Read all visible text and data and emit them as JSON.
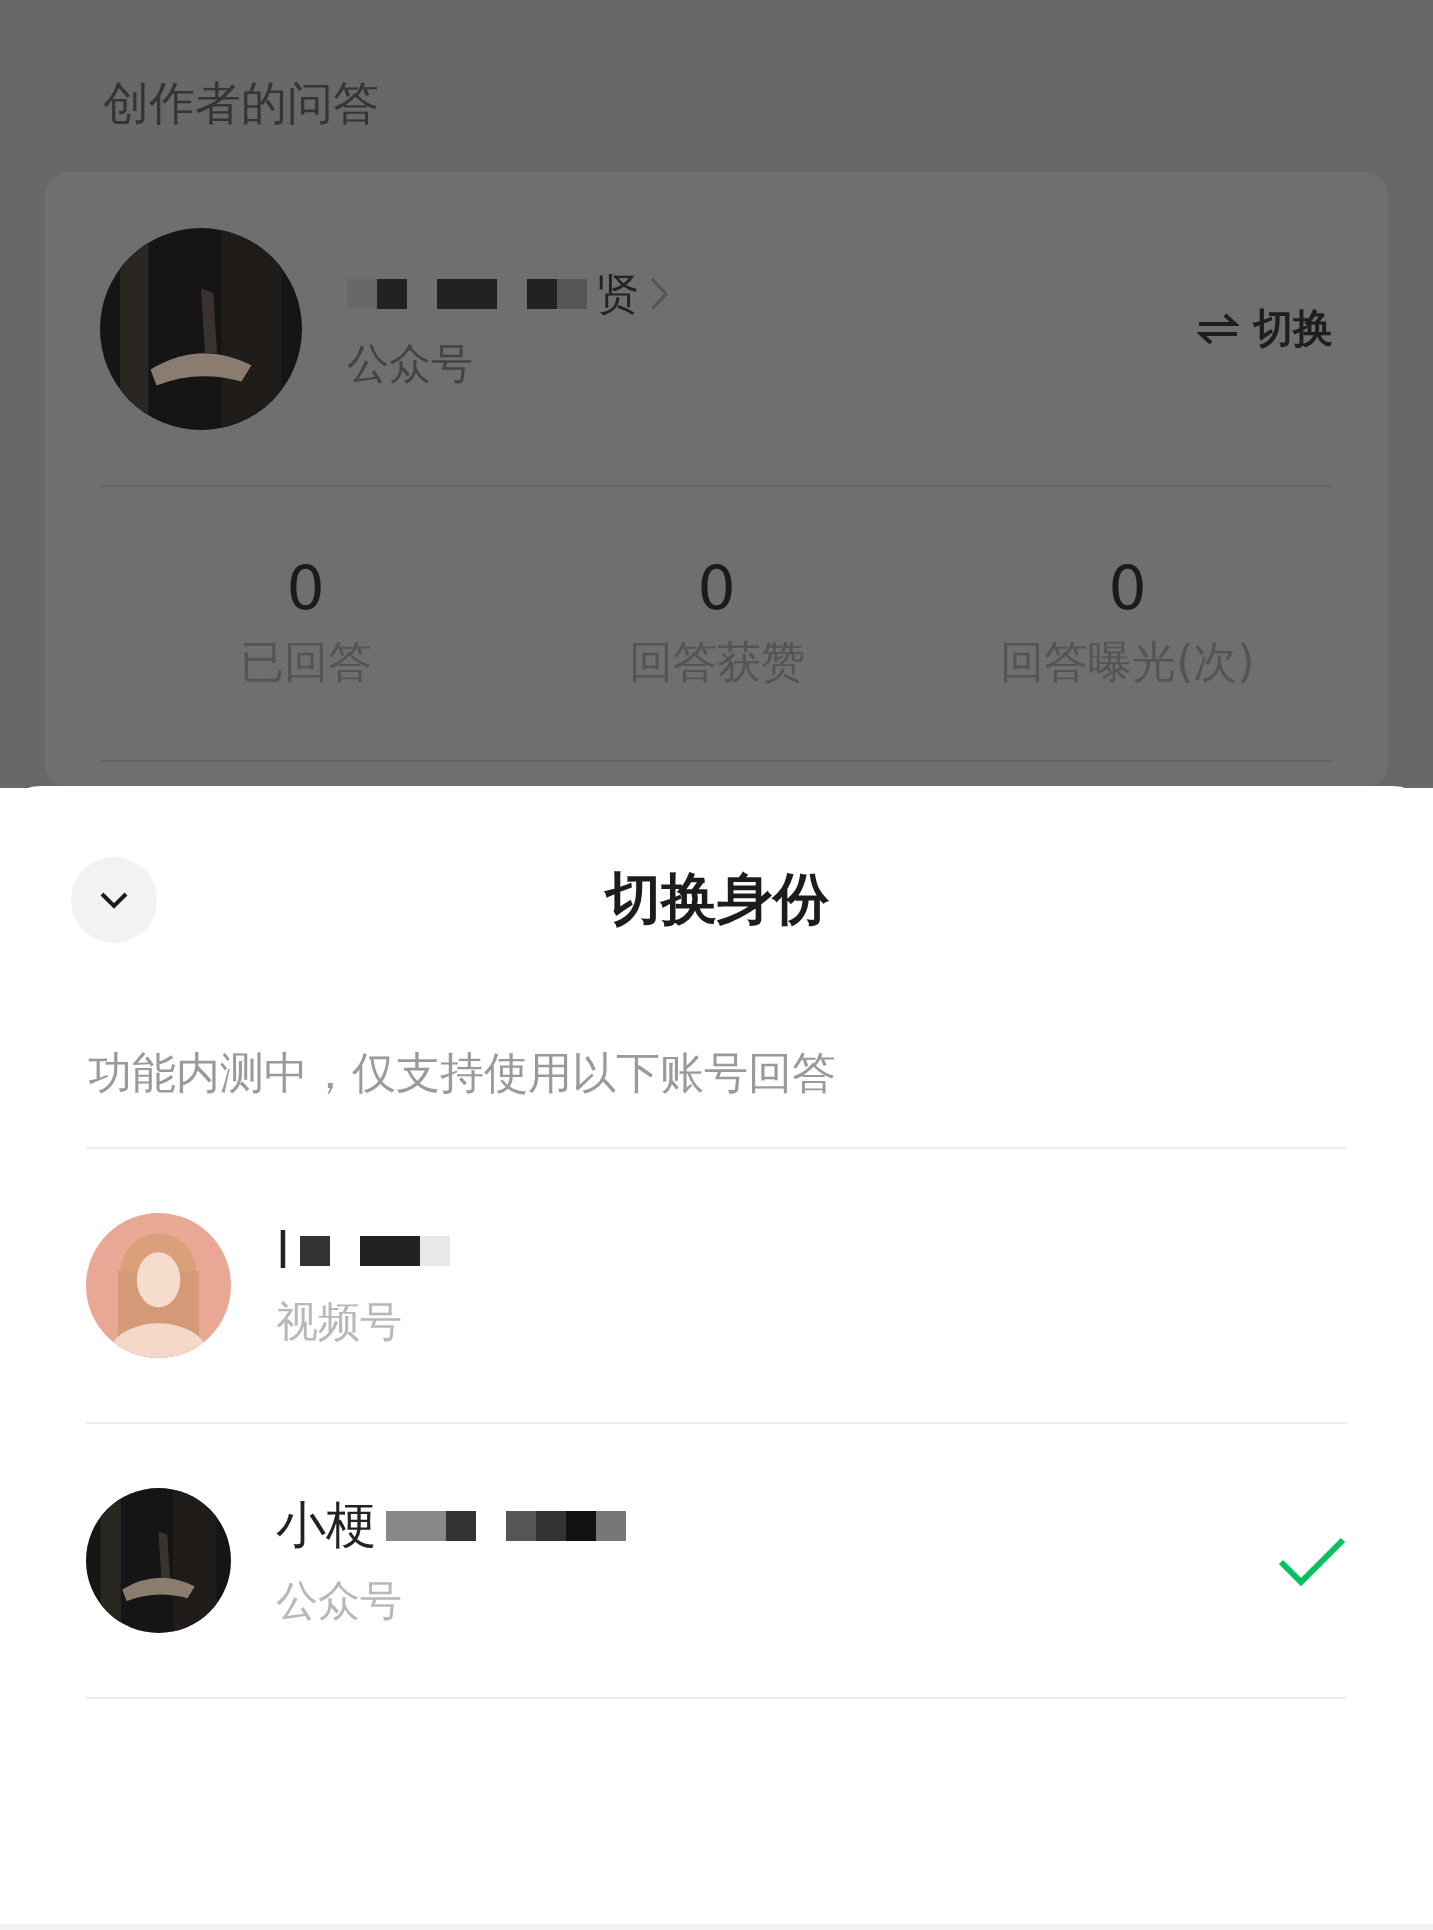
{
  "page_title": "创作者的问答",
  "card": {
    "name": "贤",
    "account_type": "公众号",
    "switch_label": "切换",
    "stats": [
      {
        "value": "0",
        "label": "已回答"
      },
      {
        "value": "0",
        "label": "回答获赞"
      },
      {
        "value": "0",
        "label": "回答曝光(次)"
      }
    ]
  },
  "sheet": {
    "title": "切换身份",
    "hint": "功能内测中，仅支持使用以下账号回答",
    "accounts": [
      {
        "name": "l",
        "type": "视频号",
        "kind": "portrait",
        "selected": false
      },
      {
        "name": "小梗",
        "type": "公众号",
        "kind": "dark",
        "selected": true
      }
    ]
  }
}
